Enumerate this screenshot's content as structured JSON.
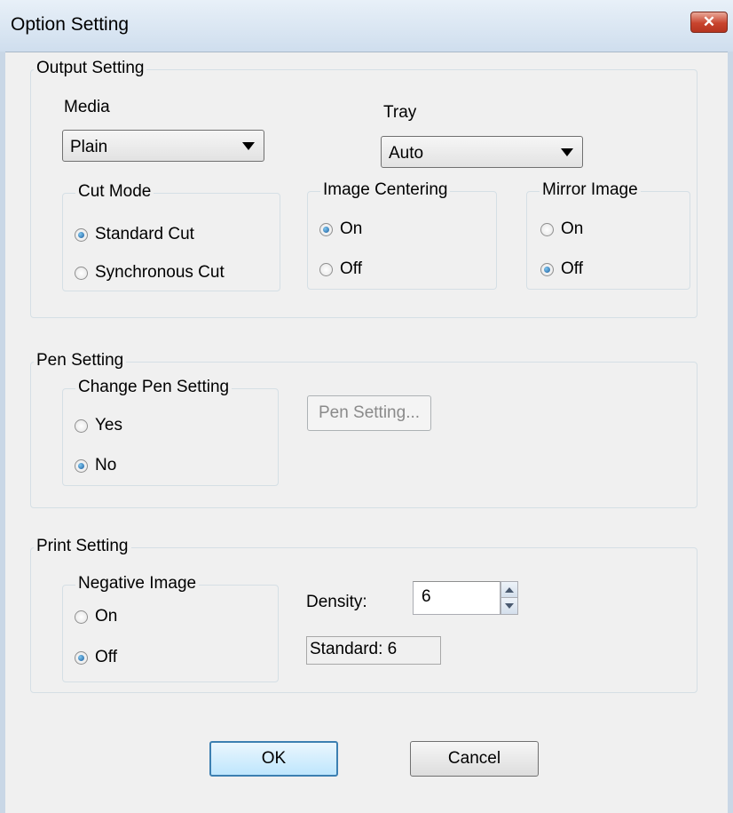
{
  "window": {
    "title": "Option Setting",
    "close_glyph": "✕"
  },
  "output": {
    "legend": "Output Setting",
    "media_label": "Media",
    "media_value": "Plain",
    "tray_label": "Tray",
    "tray_value": "Auto",
    "cut_mode": {
      "legend": "Cut Mode",
      "options": [
        "Standard Cut",
        "Synchronous Cut"
      ],
      "selected": "Standard Cut"
    },
    "image_centering": {
      "legend": "Image Centering",
      "options": [
        "On",
        "Off"
      ],
      "selected": "On"
    },
    "mirror_image": {
      "legend": "Mirror Image",
      "options": [
        "On",
        "Off"
      ],
      "selected": "Off"
    }
  },
  "pen": {
    "legend": "Pen Setting",
    "change_pen": {
      "legend": "Change Pen Setting",
      "options": [
        "Yes",
        "No"
      ],
      "selected": "No"
    },
    "pen_button": "Pen Setting..."
  },
  "print": {
    "legend": "Print Setting",
    "negative_image": {
      "legend": "Negative Image",
      "options": [
        "On",
        "Off"
      ],
      "selected": "Off"
    },
    "density_label": "Density:",
    "density_value": "6",
    "standard_text": "Standard: 6"
  },
  "buttons": {
    "ok": "OK",
    "cancel": "Cancel"
  },
  "colors": {
    "accent": "#3c7fb1",
    "close": "#c8442e",
    "dialog_bg": "#f0f0f0"
  }
}
